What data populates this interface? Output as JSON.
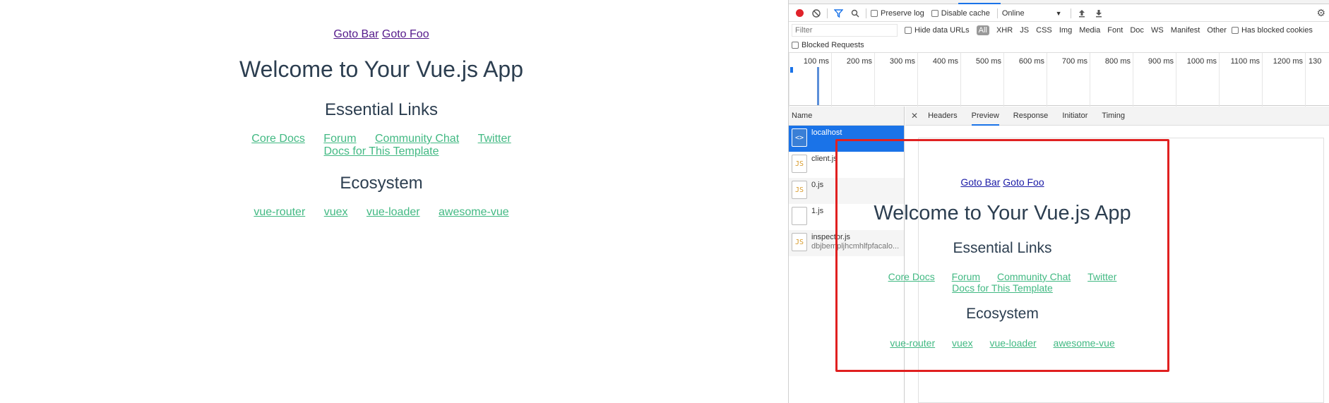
{
  "app": {
    "nav": [
      "Goto Bar",
      "Goto Foo"
    ],
    "title": "Welcome to Your Vue.js App",
    "essential_heading": "Essential Links",
    "essential_links": [
      "Core Docs",
      "Forum",
      "Community Chat",
      "Twitter",
      "Docs for This Template"
    ],
    "ecosystem_heading": "Ecosystem",
    "ecosystem_links": [
      "vue-router",
      "vuex",
      "vue-loader",
      "awesome-vue"
    ]
  },
  "devtools": {
    "toolbar": {
      "preserve_log": "Preserve log",
      "disable_cache": "Disable cache",
      "throttle": "Online"
    },
    "filter": {
      "placeholder": "Filter",
      "hide_data_urls": "Hide data URLs",
      "types": [
        "All",
        "XHR",
        "JS",
        "CSS",
        "Img",
        "Media",
        "Font",
        "Doc",
        "WS",
        "Manifest",
        "Other"
      ],
      "has_blocked_cookies": "Has blocked cookies",
      "blocked_requests": "Blocked Requests"
    },
    "timeline_ticks": [
      "100 ms",
      "200 ms",
      "300 ms",
      "400 ms",
      "500 ms",
      "600 ms",
      "700 ms",
      "800 ms",
      "900 ms",
      "1000 ms",
      "1100 ms",
      "1200 ms",
      "130"
    ],
    "name_header": "Name",
    "requests": [
      {
        "name": "localhost",
        "sub": ""
      },
      {
        "name": "client.js",
        "sub": ""
      },
      {
        "name": "0.js",
        "sub": ""
      },
      {
        "name": "1.js",
        "sub": ""
      },
      {
        "name": "inspector.js",
        "sub": "dbjbempljhcmhlfpfacalo..."
      }
    ],
    "detail_tabs": [
      "Headers",
      "Preview",
      "Response",
      "Initiator",
      "Timing"
    ],
    "active_tab": "Preview",
    "preview": {
      "nav": [
        "Goto Bar",
        "Goto Foo"
      ],
      "title": "Welcome to Your Vue.js App",
      "essential_heading": "Essential Links",
      "essential_links": [
        "Core Docs",
        "Forum",
        "Community Chat",
        "Twitter",
        "Docs for This Template"
      ],
      "ecosystem_heading": "Ecosystem",
      "ecosystem_links": [
        "vue-router",
        "vuex",
        "vue-loader",
        "awesome-vue"
      ]
    }
  }
}
